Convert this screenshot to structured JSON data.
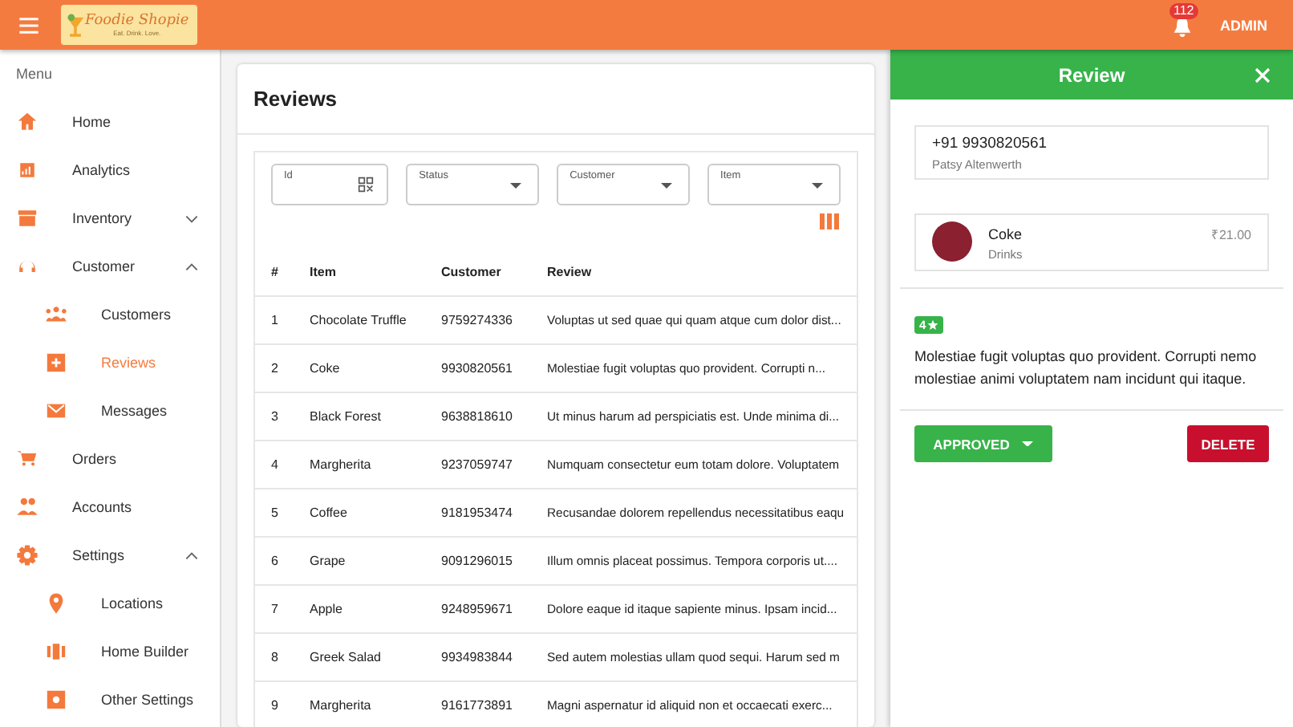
{
  "header": {
    "logo": {
      "title": "Foodie Shopie",
      "tagline": "Eat. Drink. Love."
    },
    "notifications": "112",
    "user": "ADMIN"
  },
  "sidebar": {
    "heading": "Menu",
    "items": [
      {
        "label": "Home",
        "selected": false
      },
      {
        "label": "Analytics",
        "selected": false
      },
      {
        "label": "Inventory",
        "selected": false,
        "expanded": false
      },
      {
        "label": "Customer",
        "selected": false,
        "expanded": true,
        "children": [
          {
            "label": "Customers",
            "selected": false
          },
          {
            "label": "Reviews",
            "selected": true
          },
          {
            "label": "Messages",
            "selected": false
          }
        ]
      },
      {
        "label": "Orders",
        "selected": false
      },
      {
        "label": "Accounts",
        "selected": false
      },
      {
        "label": "Settings",
        "selected": false,
        "expanded": true,
        "children": [
          {
            "label": "Locations",
            "selected": false
          },
          {
            "label": "Home Builder",
            "selected": false
          },
          {
            "label": "Other Settings",
            "selected": false
          }
        ]
      }
    ]
  },
  "page": {
    "title": "Reviews",
    "filters": [
      {
        "label": "Id",
        "kind": "qr"
      },
      {
        "label": "Status",
        "kind": "select"
      },
      {
        "label": "Customer",
        "kind": "select"
      },
      {
        "label": "Item",
        "kind": "select"
      }
    ],
    "table": {
      "columns": [
        "#",
        "Item",
        "Customer",
        "Review"
      ],
      "rows": [
        [
          "1",
          "Chocolate Truffle",
          "9759274336",
          "Voluptas ut sed quae qui quam atque cum dolor dist..."
        ],
        [
          "2",
          "Coke",
          "9930820561",
          "Molestiae fugit voluptas quo provident. Corrupti n..."
        ],
        [
          "3",
          "Black Forest",
          "9638818610",
          "Ut minus harum ad perspiciatis est. Unde minima di..."
        ],
        [
          "4",
          "Margherita",
          "9237059747",
          "Numquam consectetur eum totam dolore. Voluptatem"
        ],
        [
          "5",
          "Coffee",
          "9181953474",
          "Recusandae dolorem repellendus necessitatibus eaqu"
        ],
        [
          "6",
          "Grape",
          "9091296015",
          "Illum omnis placeat possimus. Tempora corporis ut...."
        ],
        [
          "7",
          "Apple",
          "9248959671",
          "Dolore eaque id itaque sapiente minus. Ipsam incid..."
        ],
        [
          "8",
          "Greek Salad",
          "9934983844",
          "Sed autem molestias ullam quod sequi. Harum sed m"
        ],
        [
          "9",
          "Margherita",
          "9161773891",
          "Magni aspernatur id aliquid non et occaecati exerc..."
        ]
      ]
    }
  },
  "drawer": {
    "title": "Review",
    "customer": {
      "phone": "+91 9930820561",
      "name": "Patsy Altenwerth"
    },
    "item": {
      "name": "Coke",
      "category": "Drinks",
      "price": "₹21.00"
    },
    "rating": "4",
    "text": "Molestiae fugit voluptas quo provident. Corrupti nemo molestiae animi voluptatem nam incidunt qui itaque.",
    "status": "APPROVED",
    "delete": "DELETE"
  }
}
